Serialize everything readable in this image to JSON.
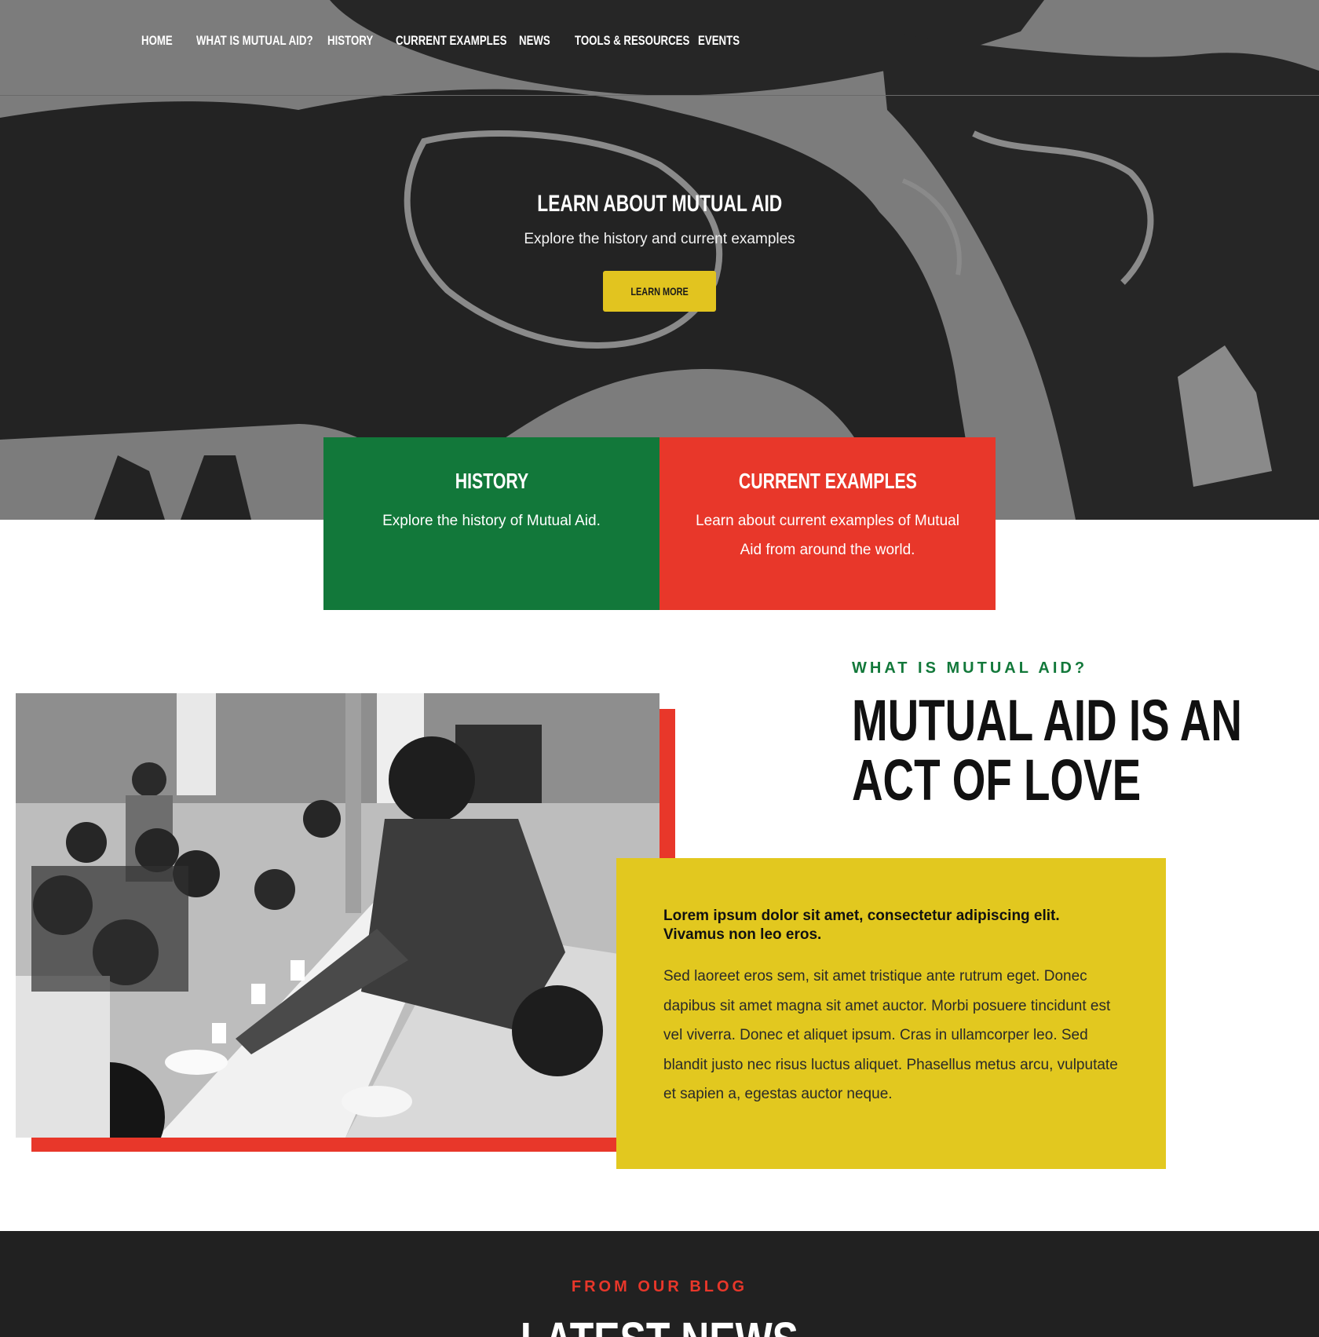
{
  "nav": {
    "items": [
      {
        "label": "HOME"
      },
      {
        "label": "WHAT IS MUTUAL AID?"
      },
      {
        "label": "HISTORY"
      },
      {
        "label": "CURRENT EXAMPLES"
      },
      {
        "label": "NEWS"
      },
      {
        "label": "TOOLS & RESOURCES"
      },
      {
        "label": "EVENTS"
      }
    ]
  },
  "hero": {
    "title": "LEARN ABOUT MUTUAL AID",
    "subtitle": "Explore the history and current examples",
    "button_label": "LEARN MORE"
  },
  "cards": [
    {
      "title": "HISTORY",
      "text": "Explore the history of Mutual Aid.",
      "color": "#12783a"
    },
    {
      "title": "CURRENT EXAMPLES",
      "text": "Learn about current examples of Mutual Aid from around the world.",
      "color": "#e8372a"
    }
  ],
  "about": {
    "eyebrow": "WHAT IS MUTUAL AID?",
    "title_line1": "MUTUAL AID IS AN",
    "title_line2": "ACT OF LOVE",
    "lead": "Lorem ipsum dolor sit amet, consectetur adipiscing elit. Vivamus non leo eros.",
    "body": "Sed laoreet eros sem, sit amet tristique ante rutrum eget. Donec dapibus sit amet magna sit amet auctor. Morbi posuere tincidunt est vel viverra. Donec et aliquet ipsum. Cras in ullamcorper leo. Sed blandit justo nec risus luctus aliquet. Phasellus metus arcu, vulputate et sapien a, egestas auctor neque."
  },
  "news": {
    "eyebrow": "FROM OUR BLOG",
    "title": "LATEST NEWS"
  },
  "colors": {
    "green": "#12783a",
    "red": "#e8372a",
    "yellow": "#e2c81f",
    "dark": "#212121"
  }
}
